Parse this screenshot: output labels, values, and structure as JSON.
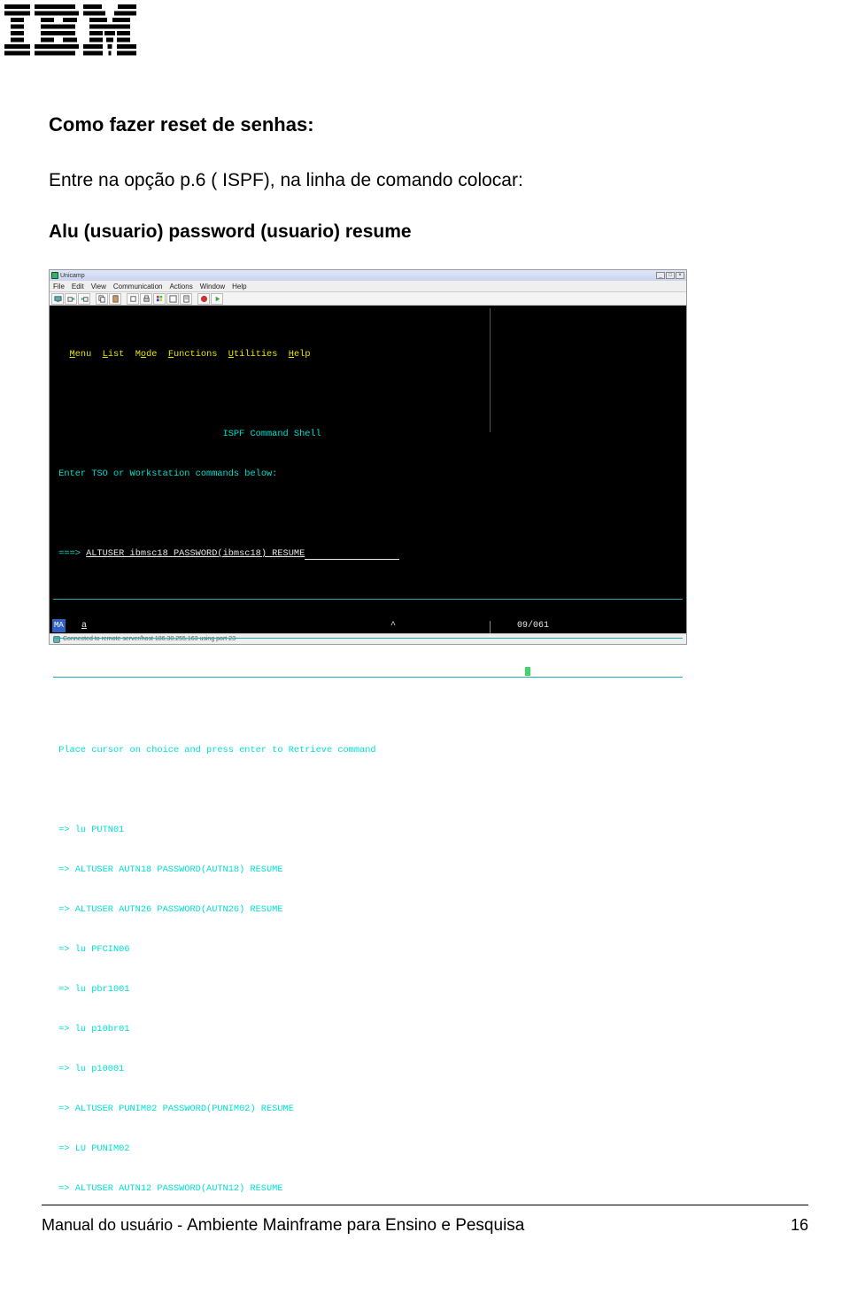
{
  "logo": {
    "alt": "IBM"
  },
  "doc": {
    "heading": "Como fazer reset de senhas:",
    "paragraph": "Entre na opção p.6 ( ISPF), na linha de comando colocar:",
    "command_example": "Alu  (usuario) password (usuario) resume"
  },
  "terminal": {
    "window_title": "Unicamp",
    "menubar": [
      "File",
      "Edit",
      "View",
      "Communication",
      "Actions",
      "Window",
      "Help"
    ],
    "toolbar_icons": [
      "host-icon",
      "send-icon",
      "recv-icon",
      "copy-icon",
      "paste-icon",
      "sep",
      "clip-icon",
      "print-icon",
      "color-icon",
      "shape-icon",
      "doc-icon",
      "sep",
      "stop-icon",
      "play-icon"
    ],
    "hotspot_menu": [
      {
        "label": "Menu",
        "u": "M"
      },
      {
        "label": "List",
        "u": "L"
      },
      {
        "label": "Mode",
        "u": "o"
      },
      {
        "label": "Functions",
        "u": "F"
      },
      {
        "label": "Utilities",
        "u": "U"
      },
      {
        "label": "Help",
        "u": "H"
      }
    ],
    "screen_title": "ISPF Command Shell",
    "prompt_line": "Enter TSO or Workstation commands below:",
    "command_prefix": "===>",
    "command_value": "ALTUSER ibmsc18 PASSWORD(ibmsc18) RESUME",
    "retrieve_hint": "Place cursor on choice and press enter to Retrieve command",
    "history": [
      "=> lu PUTN01",
      "=> ALTUSER AUTN18 PASSWORD(AUTN18) RESUME",
      "=> ALTUSER AUTN26 PASSWORD(AUTN26) RESUME",
      "=> lu PFCIN06",
      "=> lu pbr1001",
      "=> lu p10br01",
      "=> lu p10001",
      "=> ALTUSER PUNIM02 PASSWORD(PUNIM02) RESUME",
      "=> LU PUNIM02",
      "=> ALTUSER AUTN12 PASSWORD(AUTN12) RESUME"
    ],
    "status_left_badge": "MA",
    "status_a": "a",
    "status_caret": "^",
    "cursor_pos": "09/061",
    "connection_status": "Connected to remote server/host 186.30.255.163 using port 23"
  },
  "footer": {
    "text_prefix": "Manual do usuário - ",
    "text_main": "Ambiente Mainframe para Ensino e Pesquisa",
    "page_number": "16"
  }
}
